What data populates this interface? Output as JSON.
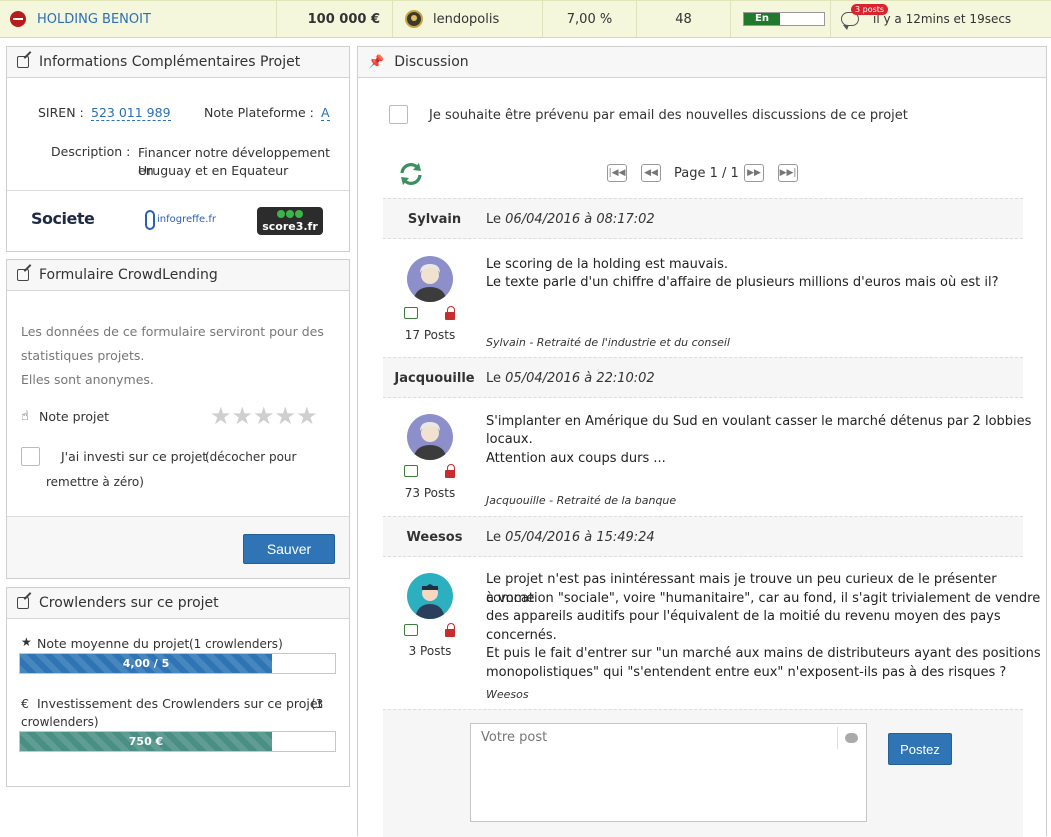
{
  "topbar": {
    "project_name": "HOLDING BENOIT",
    "amount": "100 000 €",
    "platform": "lendopolis",
    "rate": "7,00 %",
    "duration": "48",
    "status_label": "En",
    "status_fill_pct": 45,
    "posts_badge": "3 posts",
    "time_ago": "il y a 12mins et 19secs"
  },
  "info_panel": {
    "title": "Informations Complémentaires Projet",
    "siren_label": "SIREN :",
    "siren_value": "523 011 989",
    "note_label": "Note Plateforme :",
    "note_value": "A",
    "description_label": "Description :",
    "description_line1": "Financer notre développement en",
    "description_line2": "Uruguay et en Equateur",
    "logo_societe": "Societe",
    "logo_infogreffe": "infogreffe.fr",
    "logo_score3": "score3.fr"
  },
  "form_panel": {
    "title": "Formulaire CrowdLending",
    "intro_line1": "Les données de ce formulaire serviront pour des",
    "intro_line2": "statistiques projets.",
    "intro_line3": "Elles sont anonymes.",
    "rating_label": "Note projet",
    "rating_value": 0,
    "rating_max": 5,
    "invest_label_a": "J'ai investi sur ce projet",
    "invest_label_b": "(décocher pour",
    "invest_label_c": "remettre à zéro)",
    "save_label": "Sauver"
  },
  "crowd_panel": {
    "title": "Crowlenders sur ce projet",
    "avg_label": "Note moyenne du projet",
    "avg_count": "(1 crowlenders)",
    "avg_value": "4,00 / 5",
    "avg_fill_pct": 80,
    "invest_label": "Investissement des Crowlenders sur ce projet",
    "invest_count_a": "(3",
    "invest_count_b": "crowlenders)",
    "invest_value": "750 €",
    "invest_fill_pct": 80
  },
  "discussion": {
    "title": "Discussion",
    "notify_label": "Je souhaite être prévenu par email des nouvelles discussions de ce projet",
    "page_label": "Page 1 / 1",
    "comments": [
      {
        "author": "Sylvain",
        "date_prefix": "Le",
        "date": "06/04/2016 à 08:17:02",
        "line1": "Le scoring de la holding est mauvais.",
        "line2": "Le texte parle d'un chiffre d'affaire de plusieurs millions d'euros mais où est il?",
        "posts": "17 Posts",
        "signature": "Sylvain - Retraité de l'industrie et du conseil"
      },
      {
        "author": "Jacquouille",
        "date_prefix": "Le",
        "date": "05/04/2016 à 22:10:02",
        "line1": "S'implanter en Amérique du Sud en voulant casser le marché détenus par 2 lobbies",
        "line2": "locaux.",
        "line3": "Attention aux coups durs ...",
        "posts": "73 Posts",
        "signature": "Jacquouille - Retraité de la banque"
      },
      {
        "author": "Weesos",
        "date_prefix": "Le",
        "date": "05/04/2016 à 15:49:24",
        "line1": "Le projet n'est pas inintéressant mais je trouve un peu curieux de le présenter comme",
        "line2": "à vocation \"sociale\", voire \"humanitaire\", car au fond, il s'agit trivialement de vendre",
        "line3": "des appareils auditifs pour l'équivalent de la moitié du revenu moyen des pays",
        "line4": "concernés.",
        "line5": "Et puis le fait d'entrer sur \"un marché aux mains de distributeurs ayant des positions",
        "line6": "monopolistiques\" qui \"s'entendent entre eux\" n'exposent-ils pas à des risques ?",
        "posts": "3 Posts",
        "signature": "Weesos"
      }
    ],
    "post_placeholder": "Votre post",
    "post_button": "Postez"
  }
}
